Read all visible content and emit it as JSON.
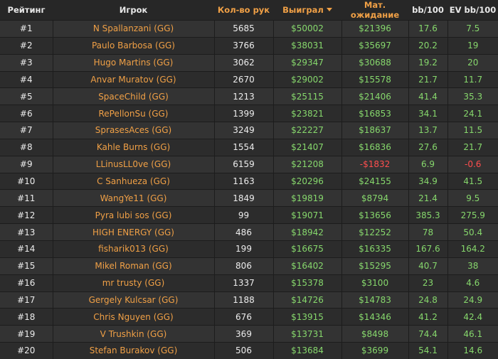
{
  "table": {
    "headers": {
      "rank": "Рейтинг",
      "player": "Игрок",
      "hands": "Кол-во рук",
      "won": "Выиграл",
      "ev": "Мат. ожидание",
      "bb100": "bb/100",
      "evbb100": "EV bb/100"
    },
    "sort": {
      "column": "won",
      "direction": "desc"
    },
    "colors": {
      "orange": "#f0a046",
      "green": "#86d76c",
      "red": "#ff4e4e",
      "background": "#2b2b2b"
    },
    "rows": [
      {
        "rank": "#1",
        "player": "N Spallanzani (GG)",
        "hands": "5685",
        "won": "$50002",
        "ev": "$21396",
        "bb100": "17.6",
        "evbb100": "7.5"
      },
      {
        "rank": "#2",
        "player": "Paulo Barbosa (GG)",
        "hands": "3766",
        "won": "$38031",
        "ev": "$35697",
        "bb100": "20.2",
        "evbb100": "19"
      },
      {
        "rank": "#3",
        "player": "Hugo Martins (GG)",
        "hands": "3062",
        "won": "$29347",
        "ev": "$30688",
        "bb100": "19.2",
        "evbb100": "20"
      },
      {
        "rank": "#4",
        "player": "Anvar Muratov (GG)",
        "hands": "2670",
        "won": "$29002",
        "ev": "$15578",
        "bb100": "21.7",
        "evbb100": "11.7"
      },
      {
        "rank": "#5",
        "player": "SpaceChild (GG)",
        "hands": "1213",
        "won": "$25115",
        "ev": "$21406",
        "bb100": "41.4",
        "evbb100": "35.3"
      },
      {
        "rank": "#6",
        "player": "RePellonSu (GG)",
        "hands": "1399",
        "won": "$23821",
        "ev": "$16853",
        "bb100": "34.1",
        "evbb100": "24.1"
      },
      {
        "rank": "#7",
        "player": "SprasesAces (GG)",
        "hands": "3249",
        "won": "$22227",
        "ev": "$18637",
        "bb100": "13.7",
        "evbb100": "11.5"
      },
      {
        "rank": "#8",
        "player": "Kahle Burns (GG)",
        "hands": "1554",
        "won": "$21407",
        "ev": "$16836",
        "bb100": "27.6",
        "evbb100": "21.7"
      },
      {
        "rank": "#9",
        "player": "LLinusLL0ve (GG)",
        "hands": "6159",
        "won": "$21208",
        "ev": "-$1832",
        "bb100": "6.9",
        "evbb100": "-0.6"
      },
      {
        "rank": "#10",
        "player": "C Sanhueza (GG)",
        "hands": "1163",
        "won": "$20296",
        "ev": "$24155",
        "bb100": "34.9",
        "evbb100": "41.5"
      },
      {
        "rank": "#11",
        "player": "WangYe11 (GG)",
        "hands": "1849",
        "won": "$19819",
        "ev": "$8794",
        "bb100": "21.4",
        "evbb100": "9.5"
      },
      {
        "rank": "#12",
        "player": "Pyra lubi sos (GG)",
        "hands": "99",
        "won": "$19071",
        "ev": "$13656",
        "bb100": "385.3",
        "evbb100": "275.9"
      },
      {
        "rank": "#13",
        "player": "HIGH ENERGY (GG)",
        "hands": "486",
        "won": "$18942",
        "ev": "$12252",
        "bb100": "78",
        "evbb100": "50.4"
      },
      {
        "rank": "#14",
        "player": "fisharik013 (GG)",
        "hands": "199",
        "won": "$16675",
        "ev": "$16335",
        "bb100": "167.6",
        "evbb100": "164.2"
      },
      {
        "rank": "#15",
        "player": "Mikel Roman (GG)",
        "hands": "806",
        "won": "$16402",
        "ev": "$15295",
        "bb100": "40.7",
        "evbb100": "38"
      },
      {
        "rank": "#16",
        "player": "mr trusty (GG)",
        "hands": "1337",
        "won": "$15378",
        "ev": "$3100",
        "bb100": "23",
        "evbb100": "4.6"
      },
      {
        "rank": "#17",
        "player": "Gergely Kulcsar (GG)",
        "hands": "1188",
        "won": "$14726",
        "ev": "$14783",
        "bb100": "24.8",
        "evbb100": "24.9"
      },
      {
        "rank": "#18",
        "player": "Chris Nguyen (GG)",
        "hands": "676",
        "won": "$13915",
        "ev": "$14346",
        "bb100": "41.2",
        "evbb100": "42.4"
      },
      {
        "rank": "#19",
        "player": "V Trushkin (GG)",
        "hands": "369",
        "won": "$13731",
        "ev": "$8498",
        "bb100": "74.4",
        "evbb100": "46.1"
      },
      {
        "rank": "#20",
        "player": "Stefan Burakov (GG)",
        "hands": "506",
        "won": "$13684",
        "ev": "$3699",
        "bb100": "54.1",
        "evbb100": "14.6"
      }
    ]
  }
}
